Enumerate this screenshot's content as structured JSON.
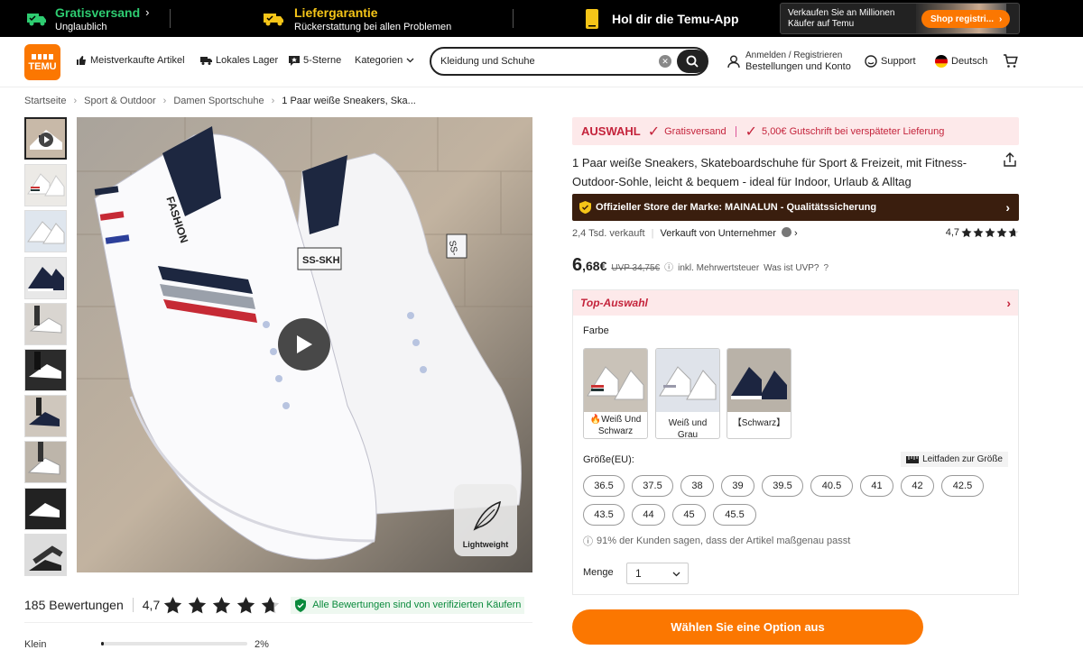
{
  "promo": {
    "shipping_title": "Gratisversand",
    "shipping_sub": "Unglaublich",
    "guarantee_title": "Liefergarantie",
    "guarantee_sub": "Rückerstattung bei allen Problemen",
    "app_title": "Hol dir die Temu-App",
    "sell_text": "Verkaufen Sie an Millionen Käufer auf Temu",
    "shop_button": "Shop registri..."
  },
  "header": {
    "logo_text": "TEMU",
    "nav": {
      "bestsellers": "Meistverkaufte Artikel",
      "local": "Lokales Lager",
      "five_star": "5-Sterne",
      "categories": "Kategorien"
    },
    "search_value": "Kleidung und Schuhe",
    "account_line1": "Anmelden / Registrieren",
    "account_line2": "Bestellungen und Konto",
    "support": "Support",
    "language": "Deutsch"
  },
  "breadcrumb": [
    "Startseite",
    "Sport & Outdoor",
    "Damen Sportschuhe",
    "1 Paar weiße Sneakers, Ska..."
  ],
  "media": {
    "badge": "Lightweight",
    "shoe_brand_text": "FASHION",
    "shoe_tag": "SS-SKH"
  },
  "reviews": {
    "count": "185 Bewertungen",
    "rating": "4,7",
    "verified": "Alle Bewertungen sind von verifizierten Käufern",
    "fit_label": "Klein",
    "fit_percent": "2%",
    "fit_fraction": 0.02
  },
  "product": {
    "banner_auswahl": "AUSWAHL",
    "banner_shipping": "Gratisversand",
    "banner_credit": "5,00€ Gutschrift bei verspäteter Lieferung",
    "title": "1 Paar weiße Sneakers, Skateboardschuhe für Sport & Freizeit, mit Fitness-Outdoor-Sohle, leicht & bequem - ideal für Indoor, Urlaub & Alltag",
    "store": "Offizieller Store der Marke: MAINALUN - Qualitätssicherung",
    "sold": "2,4 Tsd. verkauft",
    "seller": "Verkauft von Unternehmer",
    "rating": "4,7",
    "price_int": "6",
    "price_dec": ",68€",
    "uvp": "UVP 34,75€",
    "vat": "inkl. Mehrwertsteuer",
    "what_uvp": "Was ist UVP?"
  },
  "options": {
    "top_header": "Top-Auswahl",
    "color_label": "Farbe",
    "colors": [
      "Weiß Und Schwarz",
      "Weiß und Grau",
      "【Schwarz】"
    ],
    "size_label": "Größe(EU):",
    "size_guide": "Leitfaden zur Größe",
    "sizes": [
      "36.5",
      "37.5",
      "38",
      "39",
      "39.5",
      "40.5",
      "41",
      "42",
      "42.5",
      "43.5",
      "44",
      "45",
      "45.5"
    ],
    "fit_note": "91% der Kunden sagen, dass der Artikel maßgenau passt",
    "qty_label": "Menge",
    "qty_value": "1",
    "select_button": "Wählen Sie eine Option aus"
  },
  "colors": {
    "accent": "#fb7701",
    "sale_red": "#c4233b",
    "pink_bg": "#fde9ea",
    "store_bar": "#3a1e0e",
    "verified_green": "#0a8a3c"
  }
}
